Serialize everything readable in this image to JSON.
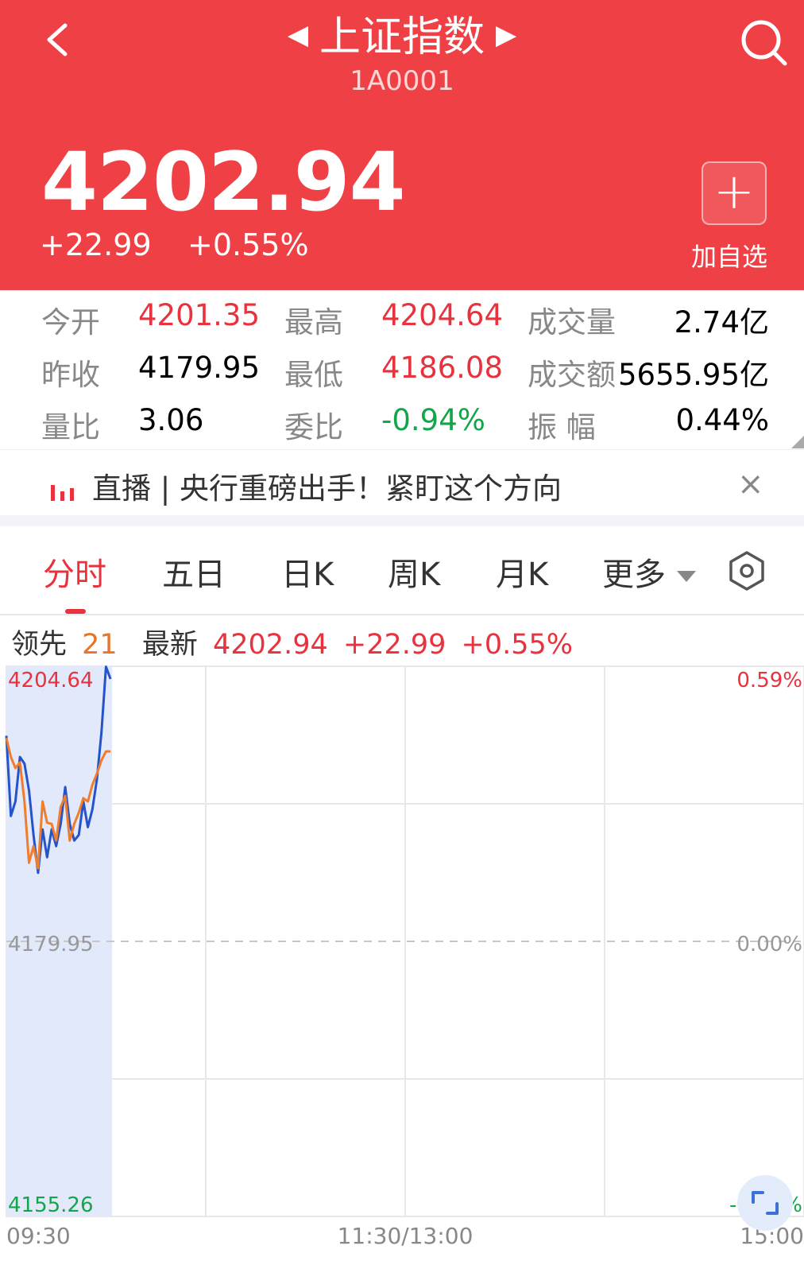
{
  "header": {
    "title": "上证指数",
    "code": "1A0001",
    "price": "4202.94",
    "change": "+22.99",
    "change_pct": "+0.55%",
    "add_label": "加自选",
    "colors": {
      "bg": "#ef4145"
    }
  },
  "stats": {
    "row1": {
      "l1": "今开",
      "v1": "4201.35",
      "l2": "最高",
      "v2": "4204.64",
      "l3": "成交量",
      "v3": "2.74亿"
    },
    "row2": {
      "l1": "昨收",
      "v1": "4179.95",
      "l2": "最低",
      "v2": "4186.08",
      "l3": "成交额",
      "v3": "5655.95亿"
    },
    "row3": {
      "l1": "量比",
      "v1": "3.06",
      "l2": "委比",
      "v2": "-0.94%",
      "l3": "振 幅",
      "v3": "0.44%"
    }
  },
  "banner": {
    "text": "直播 | 央行重磅出手！紧盯这个方向",
    "close": "×"
  },
  "tabs": [
    "分时",
    "五日",
    "日K",
    "周K",
    "月K",
    "更多"
  ],
  "legend": {
    "lead_label": "领先",
    "lead_value": "21",
    "latest_label": "最新",
    "latest_price": "4202.94",
    "latest_change": "+22.99",
    "latest_pct": "+0.55%"
  },
  "chart_data": {
    "type": "line",
    "y_labels_left": [
      "4204.64",
      "4179.95",
      "4155.26"
    ],
    "y_labels_right": [
      "0.59%",
      "0.00%",
      "-0.59%"
    ],
    "x_labels": [
      "09:30",
      "11:30/13:00",
      "15:00"
    ],
    "ylim": [
      4155.26,
      4204.64
    ],
    "prev_close": 4179.95,
    "series": [
      {
        "color": "#2553c9",
        "values": [
          4198.4,
          4191.2,
          4192.5,
          4196.5,
          4195.9,
          4193.5,
          4189.5,
          4186.1,
          4190.0,
          4187.5,
          4190.0,
          4188.5,
          4190.5,
          4193.8,
          4190.5,
          4189.0,
          4189.5,
          4192.5,
          4190.2,
          4191.8,
          4194.5,
          4198.7,
          4204.6,
          4203.5
        ]
      },
      {
        "color": "#ef7d2c",
        "values": [
          4198.2,
          4196.5,
          4195.5,
          4196.0,
          4192.5,
          4187.0,
          4188.5,
          4186.5,
          4192.5,
          4190.6,
          4190.5,
          4189.0,
          4192.0,
          4193.0,
          4189.0,
          4190.5,
          4191.5,
          4192.8,
          4192.5,
          4194.0,
          4195.0,
          4196.2,
          4197.0,
          4197.0
        ]
      }
    ],
    "colors": {
      "up": "#e8323e",
      "down": "#12a64a",
      "area": "#e1e9fb",
      "grid": "#e8e8e8"
    }
  }
}
